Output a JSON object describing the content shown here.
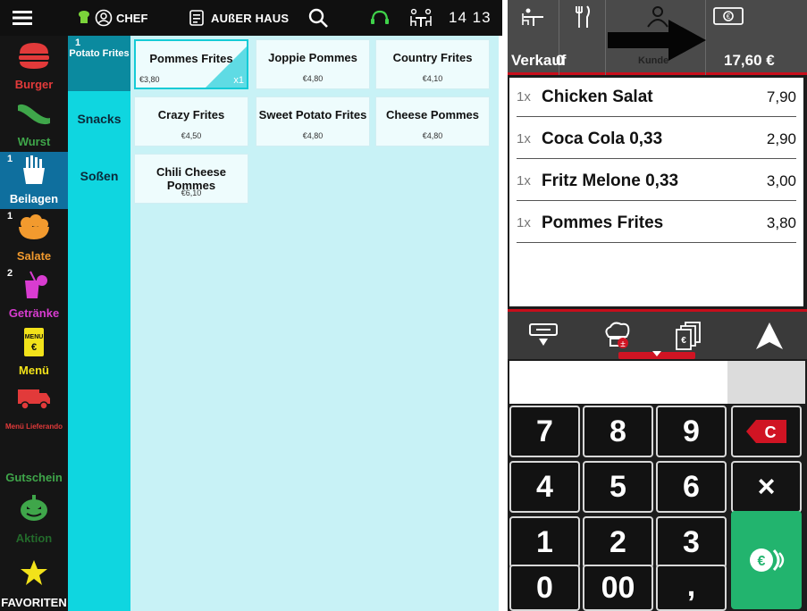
{
  "topbar": {
    "user_label": "CHEF",
    "dine_label": "AUßER HAUS",
    "time": "14 13"
  },
  "categories": [
    {
      "label": "Burger",
      "color": "#e23a3a",
      "badge": ""
    },
    {
      "label": "Wurst",
      "color": "#3fa64a",
      "badge": ""
    },
    {
      "label": "Beilagen",
      "color": "#ffffff",
      "badge": "1"
    },
    {
      "label": "Salate",
      "color": "#f29a2e",
      "badge": "1"
    },
    {
      "label": "Getränke",
      "color": "#d83cd0",
      "badge": "2"
    },
    {
      "label": "Menü",
      "color": "#f2e21a",
      "badge": ""
    },
    {
      "label": "Menü Lieferando",
      "color": "#e23a3a",
      "badge": ""
    },
    {
      "label": "Gutschein",
      "color": "#3fa64a",
      "badge": ""
    },
    {
      "label": "Aktion",
      "color": "#3fa64a",
      "badge": ""
    },
    {
      "label": "FAVORITEN",
      "color": "#ffffff",
      "badge": ""
    }
  ],
  "subcategories": [
    {
      "label": "Potato Frites",
      "badge": "1"
    },
    {
      "label": "Snacks",
      "badge": ""
    },
    {
      "label": "Soßen",
      "badge": ""
    }
  ],
  "products": [
    {
      "name": "Pommes Frites",
      "price": "€3,80",
      "qty": "x1"
    },
    {
      "name": "Joppie Pommes",
      "price": "€4,80",
      "qty": ""
    },
    {
      "name": "Country Frites",
      "price": "€4,10",
      "qty": ""
    },
    {
      "name": "Crazy Frites",
      "price": "€4,50",
      "qty": ""
    },
    {
      "name": "Sweet Potato Frites",
      "price": "€4,80",
      "qty": ""
    },
    {
      "name": "Cheese Pommes",
      "price": "€4,80",
      "qty": ""
    },
    {
      "name": "Chili Cheese Pommes",
      "price": "€6,10",
      "qty": ""
    }
  ],
  "order_header": {
    "sale_label": "Verkauf",
    "sale_count": "0",
    "customer_label": "Kunde",
    "total": "17,60 €"
  },
  "order_lines": [
    {
      "qty": "1x",
      "name": "Chicken Salat",
      "price": "7,90"
    },
    {
      "qty": "1x",
      "name": "Coca Cola 0,33",
      "price": "2,90"
    },
    {
      "qty": "1x",
      "name": "Fritz Melone 0,33",
      "price": "3,00"
    },
    {
      "qty": "1x",
      "name": "Pommes Frites",
      "price": "3,80"
    }
  ],
  "keypad": {
    "k7": "7",
    "k8": "8",
    "k9": "9",
    "clear": "C",
    "k4": "4",
    "k5": "5",
    "k6": "6",
    "multiply": "×",
    "k1": "1",
    "k2": "2",
    "k3": "3",
    "k0": "0",
    "k00": "00",
    "comma": ","
  },
  "colors": {
    "accent_red": "#c70e1b",
    "cyan": "#0fd6e0",
    "grid_bg": "#c8f2f6",
    "pay_green": "#22b46e"
  }
}
